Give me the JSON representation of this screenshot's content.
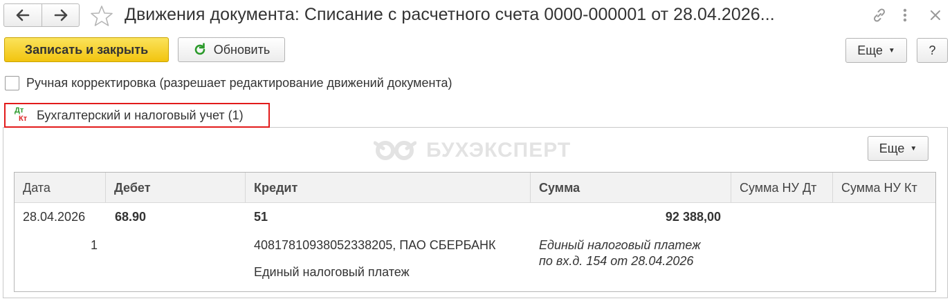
{
  "window": {
    "title": "Движения документа: Списание с расчетного счета 0000-000001 от 28.04.2026..."
  },
  "toolbar": {
    "save_close_label": "Записать и закрыть",
    "refresh_label": "Обновить",
    "more_label": "Еще",
    "help_label": "?"
  },
  "manual_edit": {
    "label": "Ручная корректировка (разрешает редактирование движений документа)",
    "checked": false
  },
  "tab": {
    "icon_top": "Дт",
    "icon_bottom": "Кт",
    "label": "Бухгалтерский и налоговый учет (1)"
  },
  "panel": {
    "watermark": "БУХЭКСПЕРТ",
    "more_label": "Еще"
  },
  "table": {
    "columns": [
      "Дата",
      "Дебет",
      "Кредит",
      "Сумма",
      "Сумма НУ Дт",
      "Сумма НУ Кт"
    ],
    "rows": [
      {
        "date": "28.04.2026",
        "line_no": "1",
        "debit": "68.90",
        "credit": "51",
        "credit_sub1": "40817810938052338205, ПАО СБЕРБАНК",
        "credit_sub2": "Единый налоговый платеж",
        "amount": "92 388,00",
        "content_line1": "Единый налоговый платеж",
        "content_line2": "по вх.д. 154 от 28.04.2026"
      }
    ]
  },
  "colors": {
    "primary_button": "#f2c40f",
    "tab_highlight": "#e21a1a",
    "dt_green": "#2b9a2b",
    "kt_red": "#dd2222"
  }
}
